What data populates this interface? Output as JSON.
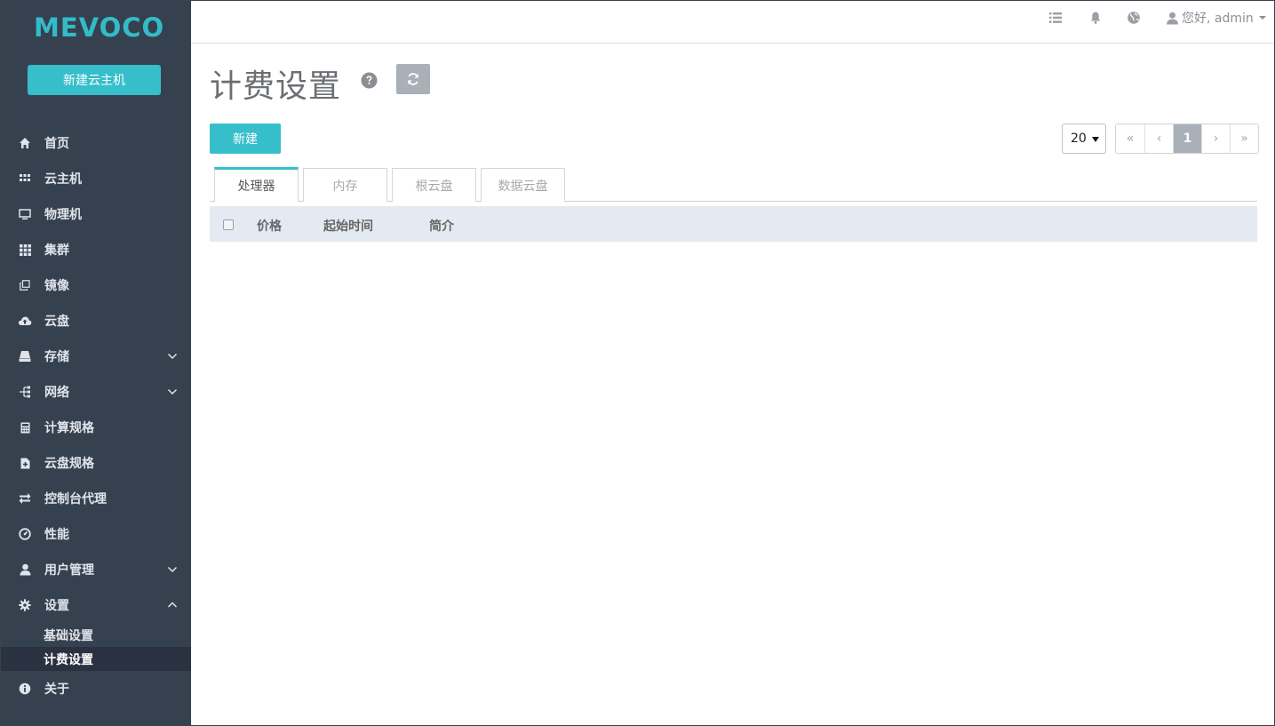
{
  "brand": {
    "logo": "MEVOCO",
    "accent": "#36bfca",
    "sidebar_bg": "#364150"
  },
  "sidebar": {
    "new_vm_label": "新建云主机",
    "items": [
      {
        "label": "首页",
        "icon": "home-icon"
      },
      {
        "label": "云主机",
        "icon": "grid-small-icon"
      },
      {
        "label": "物理机",
        "icon": "monitor-icon"
      },
      {
        "label": "集群",
        "icon": "grid-icon"
      },
      {
        "label": "镜像",
        "icon": "copy-icon"
      },
      {
        "label": "云盘",
        "icon": "cloud-upload-icon"
      },
      {
        "label": "存储",
        "icon": "hdd-icon",
        "expandable": true
      },
      {
        "label": "网络",
        "icon": "network-icon",
        "expandable": true
      },
      {
        "label": "计算规格",
        "icon": "calculator-icon"
      },
      {
        "label": "云盘规格",
        "icon": "file-plus-icon"
      },
      {
        "label": "控制台代理",
        "icon": "exchange-icon"
      },
      {
        "label": "性能",
        "icon": "dashboard-icon"
      },
      {
        "label": "用户管理",
        "icon": "user-icon",
        "expandable": true
      },
      {
        "label": "设置",
        "icon": "gear-icon",
        "expanded": true
      }
    ],
    "settings_sub": [
      {
        "label": "基础设置"
      },
      {
        "label": "计费设置",
        "active": true
      }
    ],
    "about": {
      "label": "关于",
      "icon": "info-icon"
    }
  },
  "topbar": {
    "user_greeting": "您好, admin"
  },
  "page": {
    "title": "计费设置",
    "create_label": "新建",
    "page_size": "20",
    "pager": [
      "«",
      "‹",
      "1",
      "›",
      "»"
    ]
  },
  "tabs": [
    "处理器",
    "内存",
    "根云盘",
    "数据云盘"
  ],
  "table": {
    "columns": [
      "价格",
      "起始时间",
      "简介"
    ]
  }
}
